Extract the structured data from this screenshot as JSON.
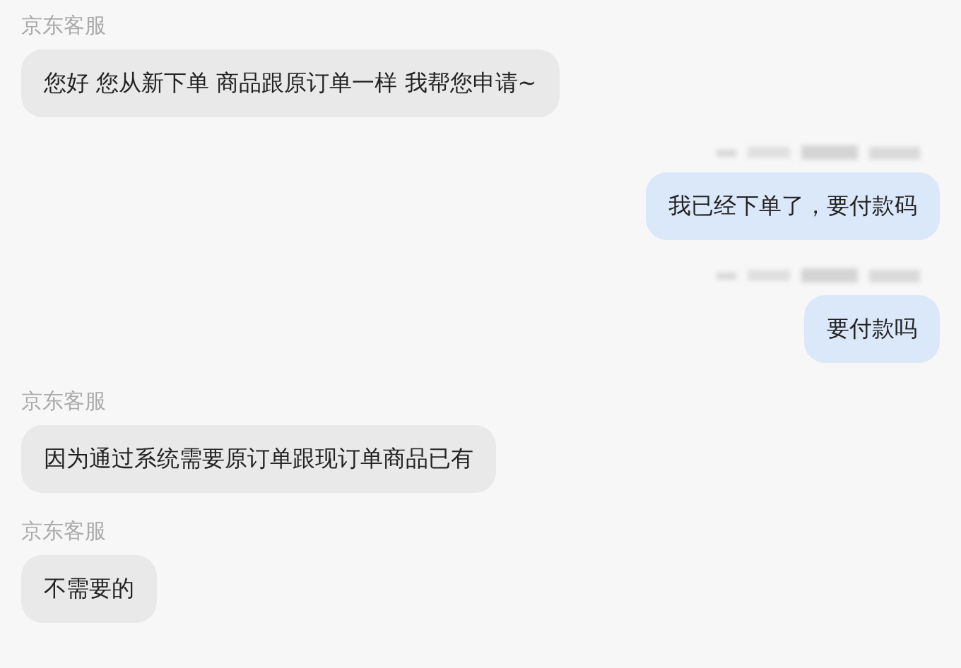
{
  "messages": [
    {
      "kind": "incoming",
      "sender": "京东客服",
      "text": "您好 您从新下单 商品跟原订单一样 我帮您申请~"
    },
    {
      "kind": "outgoing",
      "sender_redacted": true,
      "text": "我已经下单了，要付款码"
    },
    {
      "kind": "outgoing",
      "sender_redacted": true,
      "text": "要付款吗"
    },
    {
      "kind": "incoming",
      "sender": "京东客服",
      "text": "因为通过系统需要原订单跟现订单商品已有"
    },
    {
      "kind": "incoming",
      "sender": "京东客服",
      "text": "不需要的"
    }
  ]
}
